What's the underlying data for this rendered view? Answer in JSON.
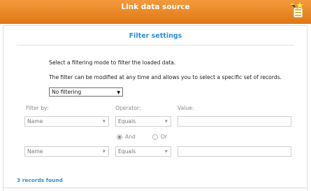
{
  "window": {
    "title": "Link data source"
  },
  "section": {
    "title": "Filter settings"
  },
  "intro": {
    "line1": "Select a filtering mode to filter the loaded data.",
    "line2": "The filter can be modified at any time and allows you to select a specific set of records."
  },
  "mode": {
    "selected": "No filtering"
  },
  "labels": {
    "filter_by": "Filter by:",
    "operator": "Operator:",
    "value": "Value:"
  },
  "row1": {
    "field": "Name",
    "operator": "Equals",
    "value": ""
  },
  "logic": {
    "and_label": "And",
    "or_label": "Or",
    "selected": "And"
  },
  "row2": {
    "field": "Name",
    "operator": "Equals",
    "value": ""
  },
  "status": {
    "text": "3 records found"
  },
  "icons": {
    "wizard": "wizard-icon"
  },
  "colors": {
    "titlebar": "#e8821f",
    "accent": "#2b8fd8"
  }
}
